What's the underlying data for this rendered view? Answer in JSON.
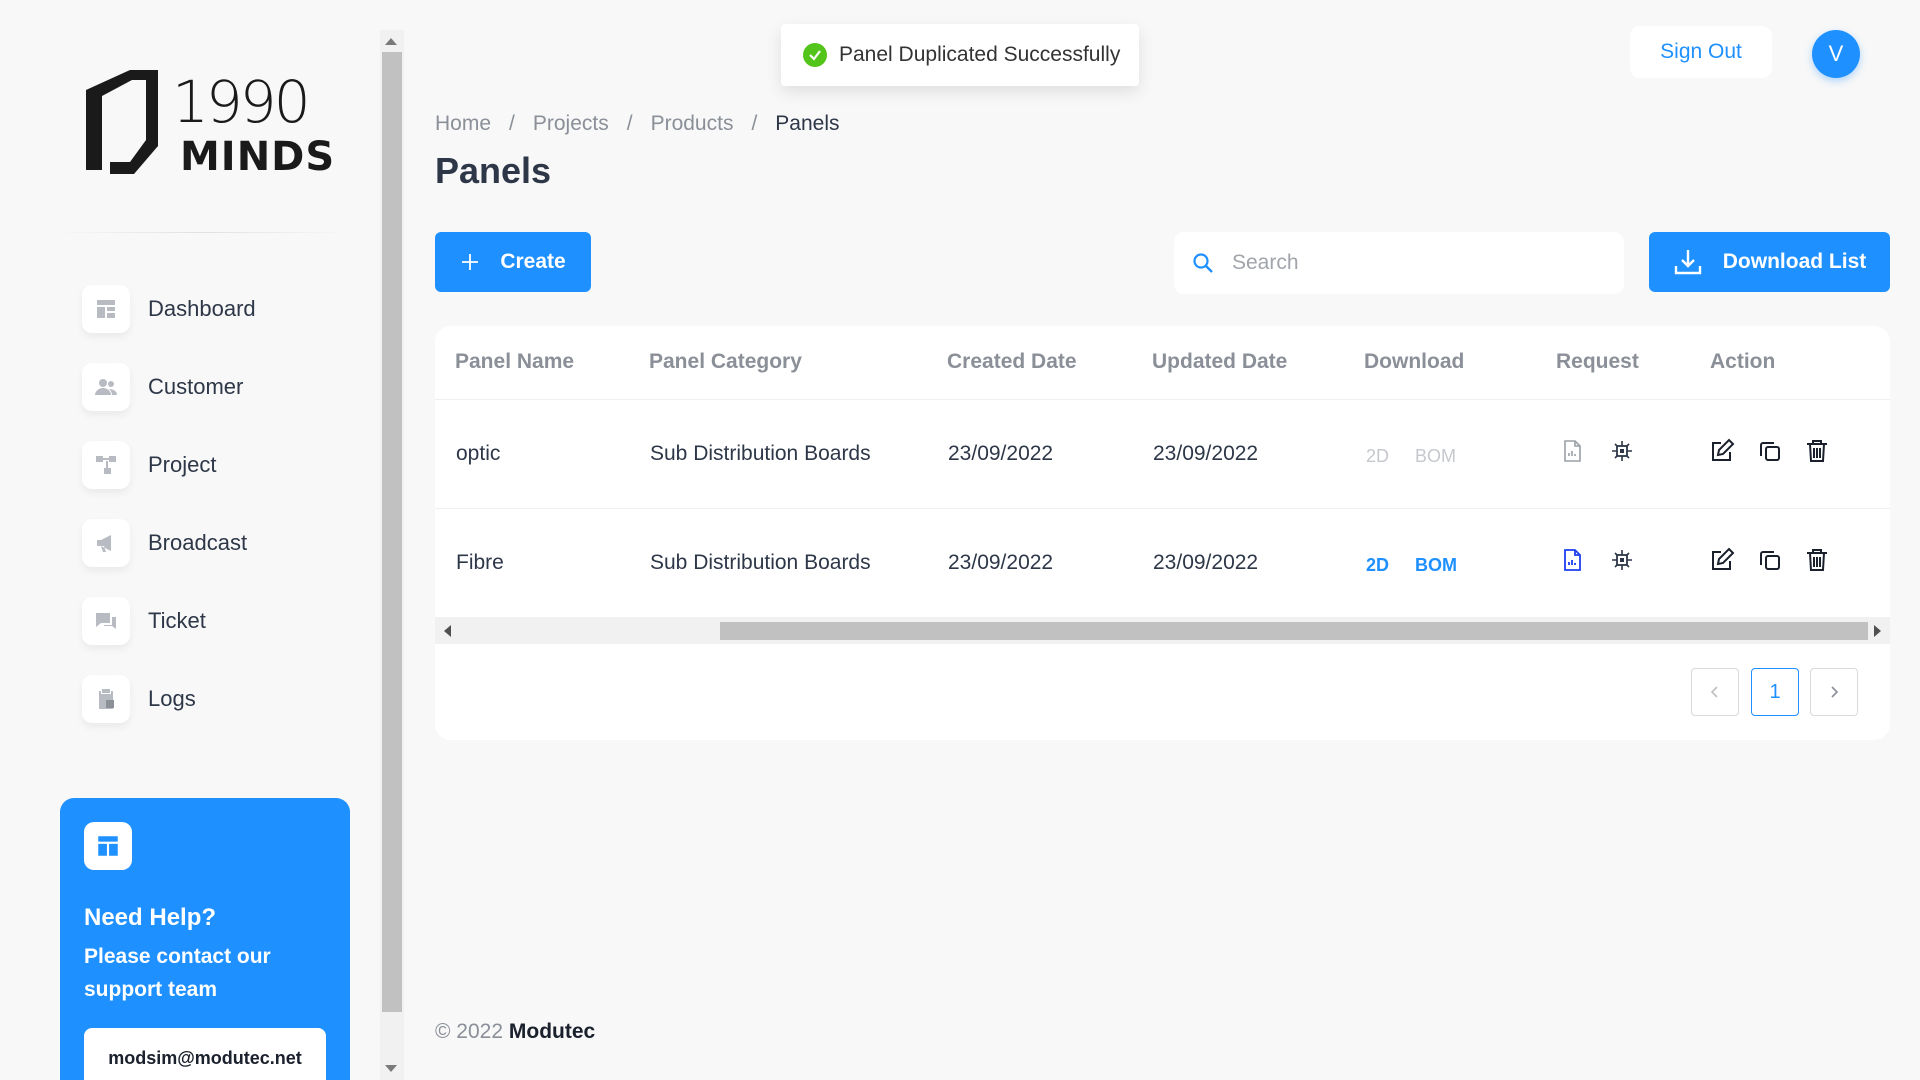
{
  "brand": {
    "logo_line1": "1990",
    "logo_line2": "MINDS"
  },
  "sidebar": {
    "items": [
      {
        "label": "Dashboard",
        "icon": "dashboard-icon"
      },
      {
        "label": "Customer",
        "icon": "users-icon"
      },
      {
        "label": "Project",
        "icon": "project-icon"
      },
      {
        "label": "Broadcast",
        "icon": "megaphone-icon"
      },
      {
        "label": "Ticket",
        "icon": "chat-icon"
      },
      {
        "label": "Logs",
        "icon": "clipboard-icon"
      }
    ],
    "help": {
      "title": "Need Help?",
      "text": "Please contact our support team",
      "email": "modsim@modutec.net"
    }
  },
  "toast": {
    "message": "Panel Duplicated Successfully"
  },
  "header": {
    "sign_out": "Sign Out",
    "avatar_initial": "V"
  },
  "breadcrumb": [
    "Home",
    "Projects",
    "Products",
    "Panels"
  ],
  "page": {
    "title": "Panels"
  },
  "toolbar": {
    "create_label": "Create",
    "search_placeholder": "Search",
    "download_label": "Download List"
  },
  "table": {
    "columns": [
      "Panel Name",
      "Panel Category",
      "Created Date",
      "Updated Date",
      "Download",
      "Request",
      "Action"
    ],
    "rows": [
      {
        "name": "optic",
        "category": "Sub Distribution Boards",
        "created": "23/09/2022",
        "updated": "23/09/2022",
        "dl_2d": "2D",
        "dl_bom": "BOM",
        "download_enabled": false
      },
      {
        "name": "Fibre",
        "category": "Sub Distribution Boards",
        "created": "23/09/2022",
        "updated": "23/09/2022",
        "dl_2d": "2D",
        "dl_bom": "BOM",
        "download_enabled": true
      }
    ]
  },
  "pagination": {
    "current_page": "1"
  },
  "footer": {
    "copyright": "© 2022",
    "company": "Modutec"
  },
  "colors": {
    "accent": "#1e90ff",
    "success": "#52c41a",
    "muted": "#8a8f98"
  }
}
